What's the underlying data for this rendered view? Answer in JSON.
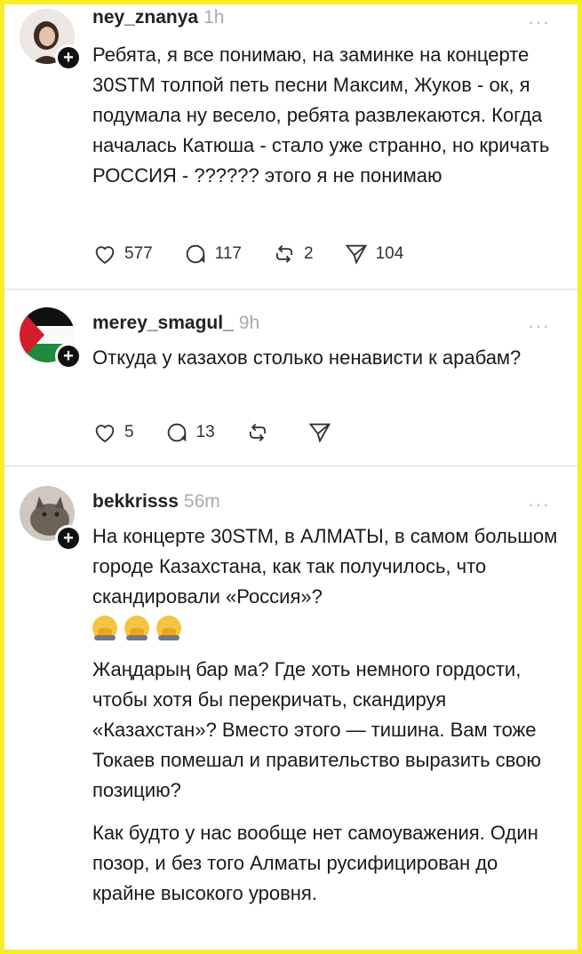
{
  "posts": [
    {
      "username": "ney_znanya",
      "time": "1h",
      "more": "···",
      "paragraphs": [
        "Ребята, я все понимаю, на заминке на концерте 30STM толпой петь песни Максим, Жуков - ок, я подумала ну весело, ребята развлекаются. Когда началась Катюша - стало уже странно, но кричать РОССИЯ - ?????? этого я не понимаю"
      ],
      "likes": "577",
      "comments": "117",
      "reposts": "2",
      "shares": "104"
    },
    {
      "username": "merey_smagul_",
      "time": "9h",
      "more": "···",
      "paragraphs": [
        "Откуда у казахов столько ненависти к арабам?"
      ],
      "likes": "5",
      "comments": "13",
      "reposts": "",
      "shares": ""
    },
    {
      "username": "bekkrisss",
      "time": "56m",
      "more": "···",
      "paragraphs": [
        "На концерте 30STM, в АЛМАТЫ, в самом большом городе Казахстана, как так получилось, что скандировали «Россия»?",
        "Жаңдарың бар ма? Где хоть немного гордости, чтобы хотя бы перекричать, скандируя «Казахстан»? Вместо этого — тишина. Вам тоже Токаев помешал и правительство выразить свою позицию?",
        "Как будто у нас вообще нет самоуважения. Один позор, и без того Алматы русифицирован до крайне высокого уровня."
      ],
      "emoji": [
        "facepalm-emoji",
        "facepalm-emoji",
        "facepalm-emoji"
      ]
    }
  ],
  "colors": {
    "frame": "#f7ec2a",
    "muted": "#aaaaaa"
  }
}
